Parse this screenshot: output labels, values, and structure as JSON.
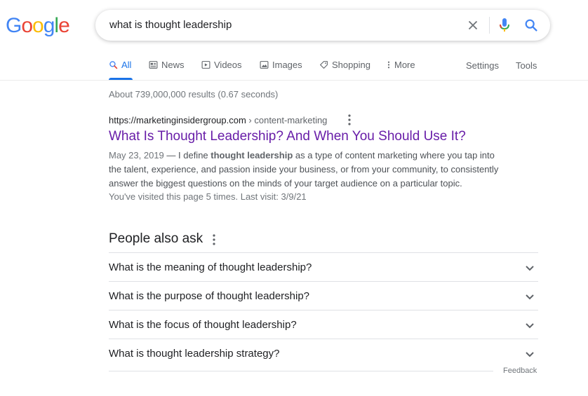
{
  "header": {
    "logo": {
      "letters": [
        {
          "ch": "G",
          "color": "#4285F4"
        },
        {
          "ch": "o",
          "color": "#EA4335"
        },
        {
          "ch": "o",
          "color": "#FBBC05"
        },
        {
          "ch": "g",
          "color": "#4285F4"
        },
        {
          "ch": "l",
          "color": "#34A853"
        },
        {
          "ch": "e",
          "color": "#EA4335"
        }
      ]
    },
    "search_query": "what is thought leadership",
    "icons": [
      "close-icon",
      "microphone-icon",
      "search-icon"
    ]
  },
  "tabs": [
    {
      "label": "All",
      "icon": "search-icon",
      "active": true
    },
    {
      "label": "News",
      "icon": "newspaper-icon",
      "active": false
    },
    {
      "label": "Videos",
      "icon": "play-icon",
      "active": false
    },
    {
      "label": "Images",
      "icon": "image-icon",
      "active": false
    },
    {
      "label": "Shopping",
      "icon": "tag-icon",
      "active": false
    },
    {
      "label": "More",
      "icon": "vertical-dots-icon",
      "active": false
    }
  ],
  "settings_label": "Settings",
  "tools_label": "Tools",
  "result_stats": "About 739,000,000 results (0.67 seconds)",
  "result": {
    "domain": "https://marketinginsidergroup.com",
    "path": " › content-marketing",
    "title": "What Is Thought Leadership? And When You Should Use It?",
    "date": "May 23, 2019",
    "snippet_pre": " — I define ",
    "snippet_bold": "thought leadership",
    "snippet_post": " as a type of content marketing where you tap into the talent, experience, and passion inside your business, or from your community, to consistently answer the biggest questions on the minds of your target audience on a particular topic.",
    "visited": "You've visited this page 5 times. Last visit: 3/9/21"
  },
  "people_also_ask": {
    "title": "People also ask",
    "questions": [
      "What is the meaning of thought leadership?",
      "What is the purpose of thought leadership?",
      "What is the focus of thought leadership?",
      "What is thought leadership strategy?"
    ]
  },
  "feedback_label": "Feedback",
  "colors": {
    "link_visited": "#681da8",
    "accent": "#1a73e8"
  }
}
